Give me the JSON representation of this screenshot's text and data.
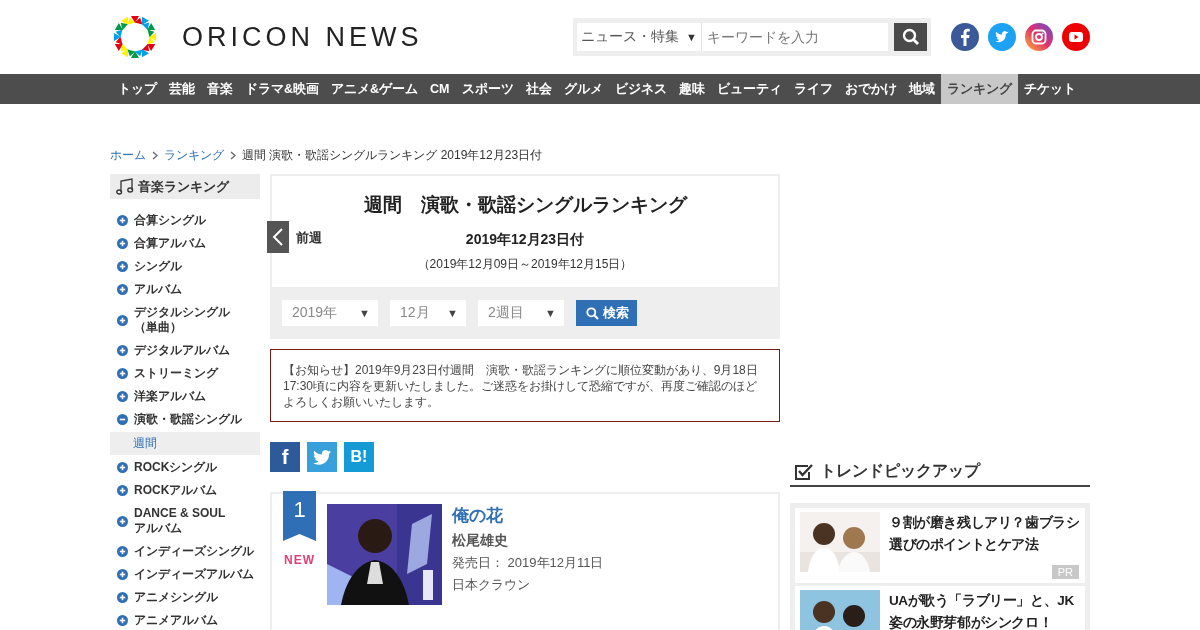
{
  "header": {
    "logo_text": "ORICON NEWS",
    "search": {
      "category": "ニュース・特集",
      "caret": "▼",
      "placeholder": "キーワードを入力"
    }
  },
  "nav": [
    {
      "label": "トップ",
      "selected": false
    },
    {
      "label": "芸能",
      "selected": false
    },
    {
      "label": "音楽",
      "selected": false
    },
    {
      "label": "ドラマ&映画",
      "selected": false
    },
    {
      "label": "アニメ&ゲーム",
      "selected": false
    },
    {
      "label": "CM",
      "selected": false
    },
    {
      "label": "スポーツ",
      "selected": false
    },
    {
      "label": "社会",
      "selected": false
    },
    {
      "label": "グルメ",
      "selected": false
    },
    {
      "label": "ビジネス",
      "selected": false
    },
    {
      "label": "趣味",
      "selected": false
    },
    {
      "label": "ビューティ",
      "selected": false
    },
    {
      "label": "ライフ",
      "selected": false
    },
    {
      "label": "おでかけ",
      "selected": false
    },
    {
      "label": "地域",
      "selected": false
    },
    {
      "label": "ランキング",
      "selected": true
    },
    {
      "label": "チケット",
      "selected": false
    }
  ],
  "breadcrumb": [
    {
      "label": "ホーム",
      "kind": "link"
    },
    {
      "label": "ランキング",
      "kind": "link"
    },
    {
      "label": "週間 演歌・歌謡シングルランキング 2019年12月23日付",
      "kind": "current"
    }
  ],
  "sidebar": {
    "title": "音楽ランキング",
    "items": [
      {
        "label": "合算シングル",
        "expanded": false
      },
      {
        "label": "合算アルバム",
        "expanded": false
      },
      {
        "label": "シングル",
        "expanded": false
      },
      {
        "label": "アルバム",
        "expanded": false
      },
      {
        "label": "デジタルシングル（単曲）",
        "expanded": false
      },
      {
        "label": "デジタルアルバム",
        "expanded": false
      },
      {
        "label": "ストリーミング",
        "expanded": false
      },
      {
        "label": "洋楽アルバム",
        "expanded": false
      },
      {
        "label": "演歌・歌謡シングル",
        "expanded": true,
        "children": [
          {
            "label": "週間",
            "selected": true
          }
        ]
      },
      {
        "label": "ROCKシングル",
        "expanded": false
      },
      {
        "label": "ROCKアルバム",
        "expanded": false
      },
      {
        "label": "DANCE & SOUL アルバム",
        "expanded": false
      },
      {
        "label": "インディーズシングル",
        "expanded": false
      },
      {
        "label": "インディーズアルバム",
        "expanded": false
      },
      {
        "label": "アニメシングル",
        "expanded": false
      },
      {
        "label": "アニメアルバム",
        "expanded": false
      }
    ]
  },
  "ranking_header": {
    "title": "週間　演歌・歌謡シングルランキング",
    "prev_label": "前週",
    "date": "2019年12月23日付",
    "period": "（2019年12月09日～2019年12月15日）",
    "selects": [
      {
        "value": "2019年",
        "caret": "▼"
      },
      {
        "value": "12月",
        "caret": "▼"
      },
      {
        "value": "2週目",
        "caret": "▼"
      }
    ],
    "search_button": "検索"
  },
  "notice": "【お知らせ】2019年9月23日付週間　演歌・歌謡ランキングに順位変動があり、9月18日17:30頃に内容を更新いたしました。ご迷惑をお掛けして恐縮ですが、再度ご確認のほどよろしくお願いいたします。",
  "share": [
    {
      "kind": "facebook",
      "label": "f"
    },
    {
      "kind": "twitter"
    },
    {
      "kind": "hatena",
      "label": "B!"
    }
  ],
  "entries": [
    {
      "rank": "1",
      "badge": "NEW",
      "title": "俺の花",
      "artist": "松尾雄史",
      "release": "発売日： 2019年12月11日",
      "label": "日本クラウン"
    }
  ],
  "trend": {
    "title": "トレンドピックアップ",
    "items": [
      {
        "text": "９割が磨き残しアリ？歯ブラシ選びのポイントとケア法",
        "tag": "PR"
      },
      {
        "text": "UAが歌う「ラブリー」と、JK姿の永野芽郁がシンクロ！"
      }
    ]
  }
}
